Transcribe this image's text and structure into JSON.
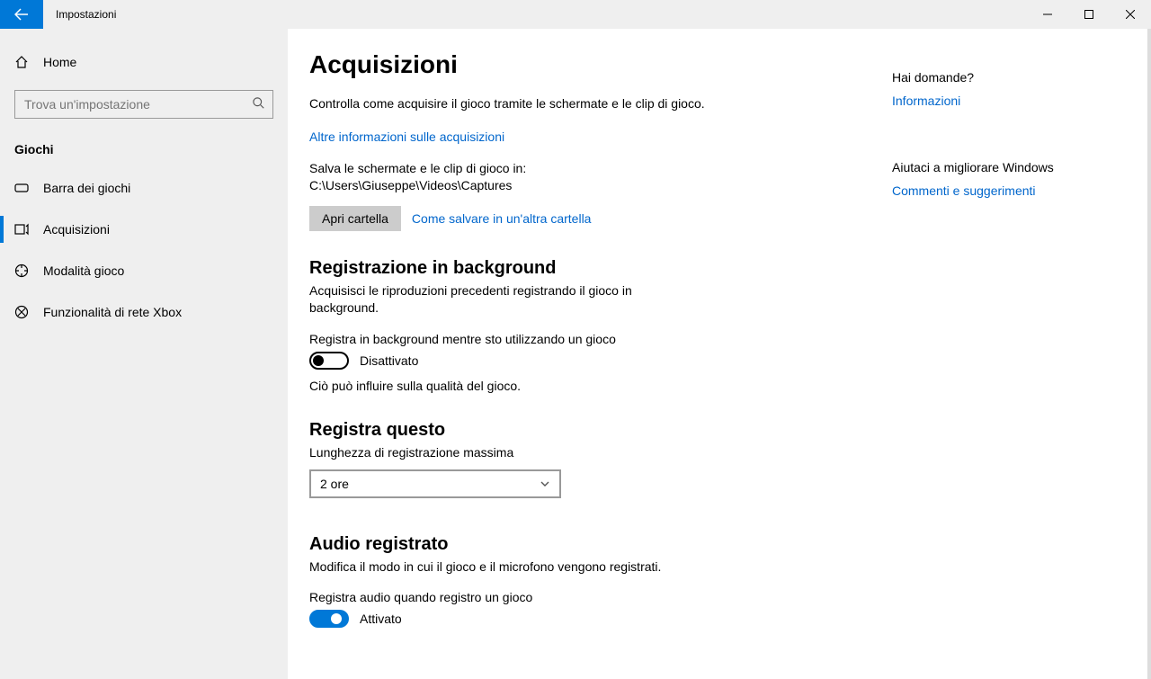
{
  "titlebar": {
    "title": "Impostazioni"
  },
  "sidebar": {
    "home_label": "Home",
    "search_placeholder": "Trova un'impostazione",
    "category": "Giochi",
    "items": [
      {
        "label": "Barra dei giochi"
      },
      {
        "label": "Acquisizioni"
      },
      {
        "label": "Modalità gioco"
      },
      {
        "label": "Funzionalità di rete Xbox"
      }
    ]
  },
  "page": {
    "title": "Acquisizioni",
    "intro": "Controlla come acquisire il gioco tramite le schermate e le clip di gioco.",
    "more_info_link": "Altre informazioni sulle acquisizioni",
    "save_path_text": "Salva le schermate e le clip di gioco in: C:\\Users\\Giuseppe\\Videos\\Captures",
    "open_folder_btn": "Apri cartella",
    "how_save_link": "Come salvare in un'altra cartella",
    "bg_rec_heading": "Registrazione in background",
    "bg_rec_desc": "Acquisisci le riproduzioni precedenti registrando il gioco in background.",
    "bg_rec_toggle_label": "Registra in background mentre sto utilizzando un gioco",
    "bg_rec_toggle_state": "Disattivato",
    "bg_rec_note": "Ciò può influire sulla qualità del gioco.",
    "rec_this_heading": "Registra questo",
    "rec_this_sub": "Lunghezza di registrazione massima",
    "rec_this_value": "2 ore",
    "audio_heading": "Audio registrato",
    "audio_desc": "Modifica il modo in cui il gioco e il microfono vengono registrati.",
    "audio_toggle_label": "Registra audio quando registro un gioco",
    "audio_toggle_state": "Attivato"
  },
  "right_rail": {
    "q_heading": "Hai domande?",
    "q_link": "Informazioni",
    "help_heading": "Aiutaci a migliorare Windows",
    "help_link": "Commenti e suggerimenti"
  }
}
